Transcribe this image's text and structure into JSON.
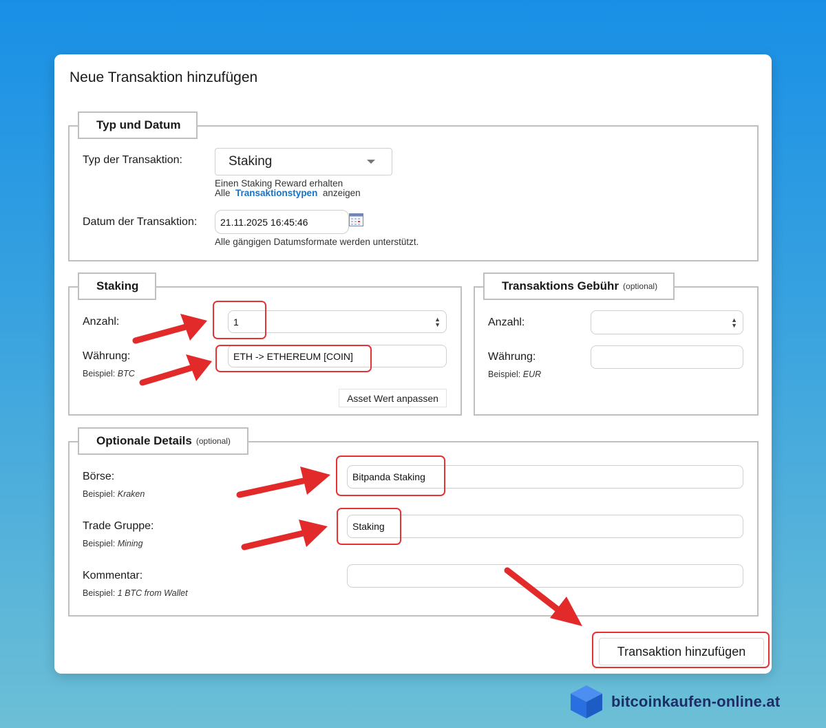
{
  "dialog": {
    "title": "Neue Transaktion hinzufügen"
  },
  "typ_datum": {
    "legend": "Typ und Datum",
    "type_label": "Typ der Transaktion:",
    "type_value": "Staking",
    "type_desc": "Einen Staking Reward erhalten",
    "types_prefix": "Alle",
    "types_link": "Transaktionstypen",
    "types_suffix": "anzeigen",
    "date_label": "Datum der Transaktion:",
    "date_value": "21.11.2025 16:45:46",
    "date_hint": "Alle gängigen Datumsformate werden unterstützt."
  },
  "staking": {
    "legend": "Staking",
    "amount_label": "Anzahl:",
    "amount_value": "1",
    "currency_label": "Währung:",
    "currency_value": "ETH -> ETHEREUM [COIN]",
    "example_prefix": "Beispiel:",
    "example_value": "BTC",
    "adjust_button": "Asset Wert anpassen"
  },
  "fee": {
    "legend": "Transaktions Gebühr",
    "optional": "(optional)",
    "amount_label": "Anzahl:",
    "amount_value": "",
    "currency_label": "Währung:",
    "currency_value": "",
    "example_prefix": "Beispiel:",
    "example_value": "EUR"
  },
  "optional": {
    "legend": "Optionale Details",
    "optional": "(optional)",
    "exchange_label": "Börse:",
    "exchange_value": "Bitpanda Staking",
    "exchange_example_prefix": "Beispiel:",
    "exchange_example": "Kraken",
    "group_label": "Trade Gruppe:",
    "group_value": "Staking",
    "group_example_prefix": "Beispiel:",
    "group_example": "Mining",
    "comment_label": "Kommentar:",
    "comment_value": "",
    "comment_example_prefix": "Beispiel:",
    "comment_example": "1 BTC from Wallet"
  },
  "submit": {
    "label": "Transaktion hinzufügen"
  },
  "brand": {
    "name": "bitcoinkaufen-online.at"
  },
  "colors": {
    "highlight": "#e53232",
    "link": "#1672c6",
    "brand": "#1b2f66",
    "cube": "#2a6fe0"
  }
}
